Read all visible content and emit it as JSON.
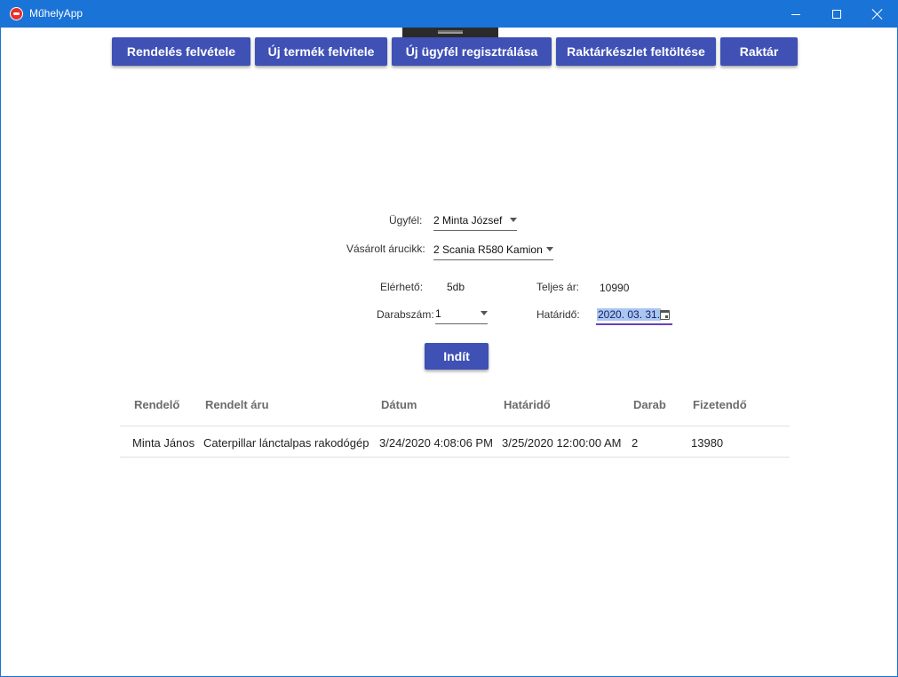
{
  "window": {
    "title": "MűhelyApp",
    "accent_color": "#1a73d6",
    "button_color": "#3f51b5"
  },
  "nav": {
    "items": [
      {
        "label": "Rendelés felvétele"
      },
      {
        "label": "Új termék felvitele"
      },
      {
        "label": "Új ügyfél regisztrálása"
      },
      {
        "label": "Raktárkészlet feltöltése"
      },
      {
        "label": "Raktár"
      }
    ]
  },
  "form": {
    "customer_label": "Ügyfél:",
    "customer_value": "2 Minta József",
    "product_label": "Vásárolt árucikk:",
    "product_value": "2 Scania R580 Kamion",
    "available_label": "Elérhető:",
    "available_value": "5db",
    "total_label": "Teljes ár:",
    "total_value": "10990",
    "quantity_label": "Darabszám:",
    "quantity_value": "1",
    "deadline_label": "Határidő:",
    "deadline_value": "2020. 03. 31.",
    "start_label": "Indít"
  },
  "table": {
    "headers": [
      "Rendelő",
      "Rendelt áru",
      "Dátum",
      "Határidő",
      "Darab",
      "Fizetendő"
    ],
    "rows": [
      [
        "Minta János",
        "Caterpillar lánctalpas rakodógép",
        "3/24/2020 4:08:06 PM",
        "3/25/2020 12:00:00 AM",
        "2",
        "13980"
      ]
    ]
  }
}
